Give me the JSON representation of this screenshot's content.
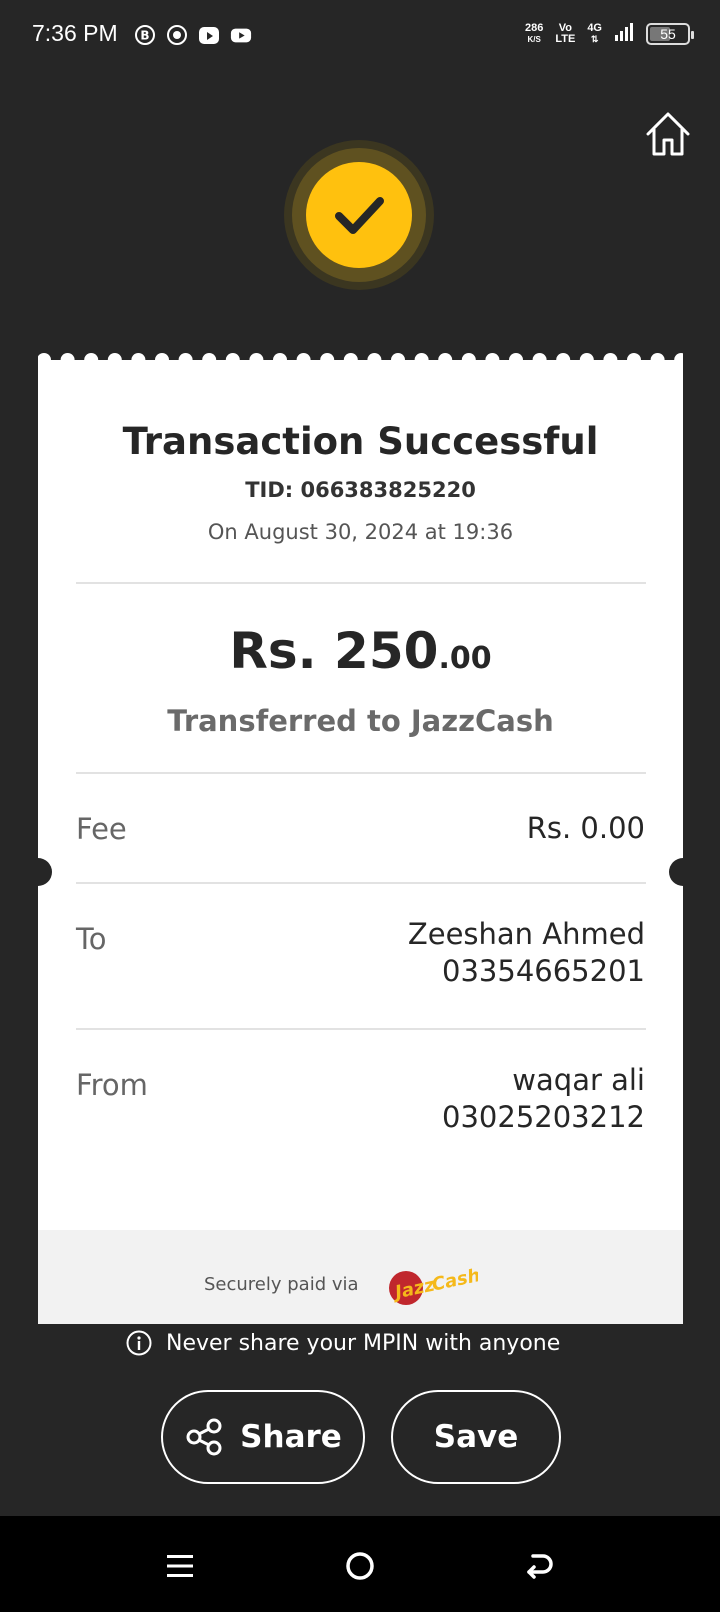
{
  "status_bar": {
    "time": "7:36 PM",
    "net_speed_value": "286",
    "net_speed_unit": "K/S",
    "volte_top": "Vo",
    "volte_bottom": "LTE",
    "network": "4G",
    "battery_percent": "55",
    "battery_level": 0.55,
    "notification_icons": [
      "b-icon",
      "circle-dot-icon",
      "video-app-icon",
      "youtube-icon"
    ]
  },
  "header": {
    "home_icon": "home-icon",
    "success_icon": "checkmark-icon",
    "accent_color": "#ffc10e"
  },
  "receipt": {
    "title": "Transaction Successful",
    "tid": "TID: 066383825220",
    "date": "On August 30, 2024 at 19:36",
    "amount_main": "Rs. 250",
    "amount_decimal": ".00",
    "transferred_to": "Transferred to JazzCash",
    "fee_label": "Fee",
    "fee_value": "Rs. 0.00",
    "to_label": "To",
    "to_name": "Zeeshan Ahmed",
    "to_number": "03354665201",
    "from_label": "From",
    "from_name": "waqar ali",
    "from_number": "03025203212",
    "secure_text": "Securely paid via",
    "logo_text": "JazzCash"
  },
  "warning": {
    "text": "Never share your MPIN with anyone",
    "icon": "info-icon"
  },
  "actions": {
    "share_label": "Share",
    "save_label": "Save"
  },
  "navbar": {
    "items": [
      "menu-icon",
      "home-circle-icon",
      "back-icon"
    ]
  }
}
